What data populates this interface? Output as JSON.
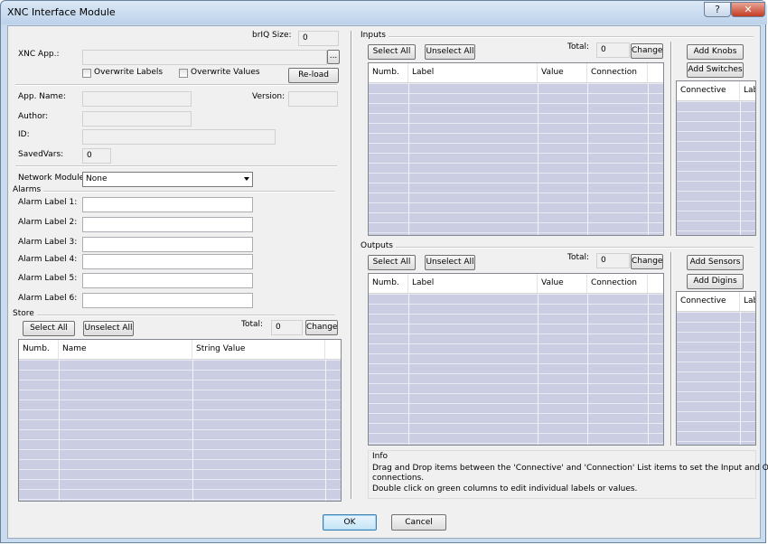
{
  "window": {
    "title": "XNC Interface Module",
    "help_label": "?",
    "close_label": "✕"
  },
  "app": {
    "briq_label": "brIQ Size:",
    "briq_value": "0",
    "xnc_app_label": "XNC App.:",
    "xnc_app_value": "",
    "browse_label": "...",
    "overwrite_labels": "Overwrite Labels",
    "overwrite_values": "Overwrite Values",
    "reload_label": "Re-load",
    "app_name_label": "App. Name:",
    "version_label": "Version:",
    "author_label": "Author:",
    "id_label": "ID:",
    "savedvars_label": "SavedVars:",
    "savedvars_value": "0"
  },
  "network": {
    "label": "Network Module:",
    "value": "None"
  },
  "alarms": {
    "title": "Alarms",
    "labels": [
      "Alarm Label 1:",
      "Alarm Label 2:",
      "Alarm Label 3:",
      "Alarm Label 4:",
      "Alarm Label 5:",
      "Alarm Label 6:"
    ]
  },
  "store": {
    "title": "Store",
    "select_all": "Select All",
    "unselect_all": "Unselect All",
    "total_label": "Total:",
    "total_value": "0",
    "change_label": "Change",
    "columns": [
      "Numb.",
      "Name",
      "String Value"
    ]
  },
  "inputs": {
    "title": "Inputs",
    "select_all": "Select All",
    "unselect_all": "Unselect All",
    "total_label": "Total:",
    "total_value": "0",
    "change_label": "Change",
    "columns": [
      "Numb.",
      "Label",
      "Value",
      "Connection"
    ],
    "add_knobs": "Add Knobs",
    "add_switches": "Add Switches",
    "connective_columns": [
      "Connective",
      "Label"
    ]
  },
  "outputs": {
    "title": "Outputs",
    "select_all": "Select All",
    "unselect_all": "Unselect All",
    "total_label": "Total:",
    "total_value": "0",
    "change_label": "Change",
    "columns": [
      "Numb.",
      "Label",
      "Value",
      "Connection"
    ],
    "add_sensors": "Add Sensors",
    "add_digins": "Add Digins",
    "connective_columns": [
      "Connective",
      "Label"
    ]
  },
  "info": {
    "title": "Info",
    "line1": "Drag and Drop items between the 'Connective' and  'Connection' List items to set the Input and Output",
    "line2": "connections.",
    "line3": "Double click on green  columns to edit individual  labels or values."
  },
  "footer": {
    "ok_label": "OK",
    "cancel_label": "Cancel"
  }
}
